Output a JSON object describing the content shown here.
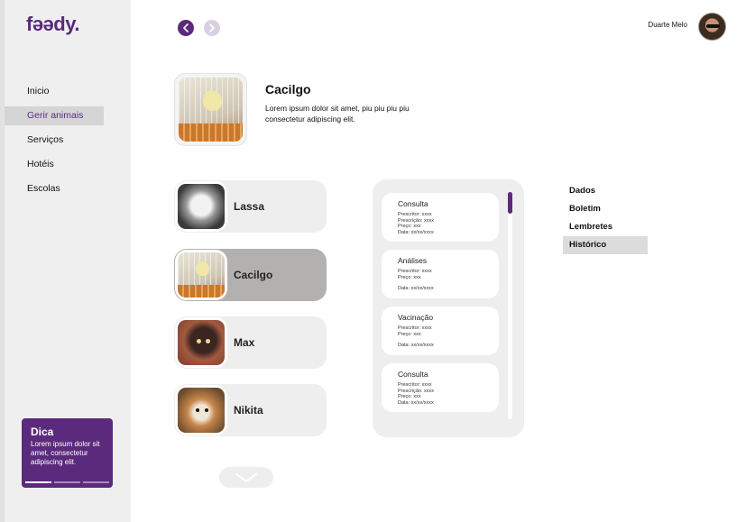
{
  "brand": {
    "logo": "fǝǝdy.",
    "accent_color": "#5b2a7c"
  },
  "sidebar": {
    "items": [
      {
        "label": "Inicio",
        "active": false
      },
      {
        "label": "Gerir animais",
        "active": true
      },
      {
        "label": "Serviços",
        "active": false
      },
      {
        "label": "Hotéis",
        "active": false
      },
      {
        "label": "Escolas",
        "active": false
      }
    ],
    "tip": {
      "title": "Dica",
      "text": "Lorem ipsum dolor sit amet, consectetur adipiscing elit.",
      "active_page": 1,
      "page_count": 3
    }
  },
  "header": {
    "back_icon": "chevron-left-icon",
    "forward_icon": "chevron-right-icon",
    "user_name": "Duarte Melo"
  },
  "featured": {
    "name": "Cacilgo",
    "description": "Lorem ipsum dolor sit amet,  piu piu piu piu consectetur adipiscing elit."
  },
  "pets": [
    {
      "name": "Lassa",
      "selected": false,
      "photo": "white-cat"
    },
    {
      "name": "Cacilgo",
      "selected": true,
      "photo": "canary"
    },
    {
      "name": "Max",
      "selected": false,
      "photo": "dog"
    },
    {
      "name": "Nikita",
      "selected": false,
      "photo": "pomeranian"
    }
  ],
  "records": [
    {
      "title": "Consulta",
      "lines": [
        "Prescritor: xxxx",
        "Prescrição: xxxx",
        "Preço: xxx",
        "Data: xx/xx/xxxx"
      ]
    },
    {
      "title": "Análises",
      "lines": [
        "Prescritor: xxxx",
        "Preço: xxx",
        "",
        "Data: xx/xx/xxxx"
      ]
    },
    {
      "title": "Vacinação",
      "lines": [
        "Prescritor: xxxx",
        "Preço: xxx",
        "",
        "Data: xx/xx/xxxx"
      ]
    },
    {
      "title": "Consulta",
      "lines": [
        "Prescritor: xxxx",
        "Prescrição: xxxx",
        "Preço: xxx",
        "Data: xx/xx/xxxx"
      ]
    }
  ],
  "tabs": [
    {
      "label": "Dados",
      "active": false
    },
    {
      "label": "Boletim",
      "active": false
    },
    {
      "label": "Lembretes",
      "active": false
    },
    {
      "label": "Histórico",
      "active": true
    }
  ]
}
